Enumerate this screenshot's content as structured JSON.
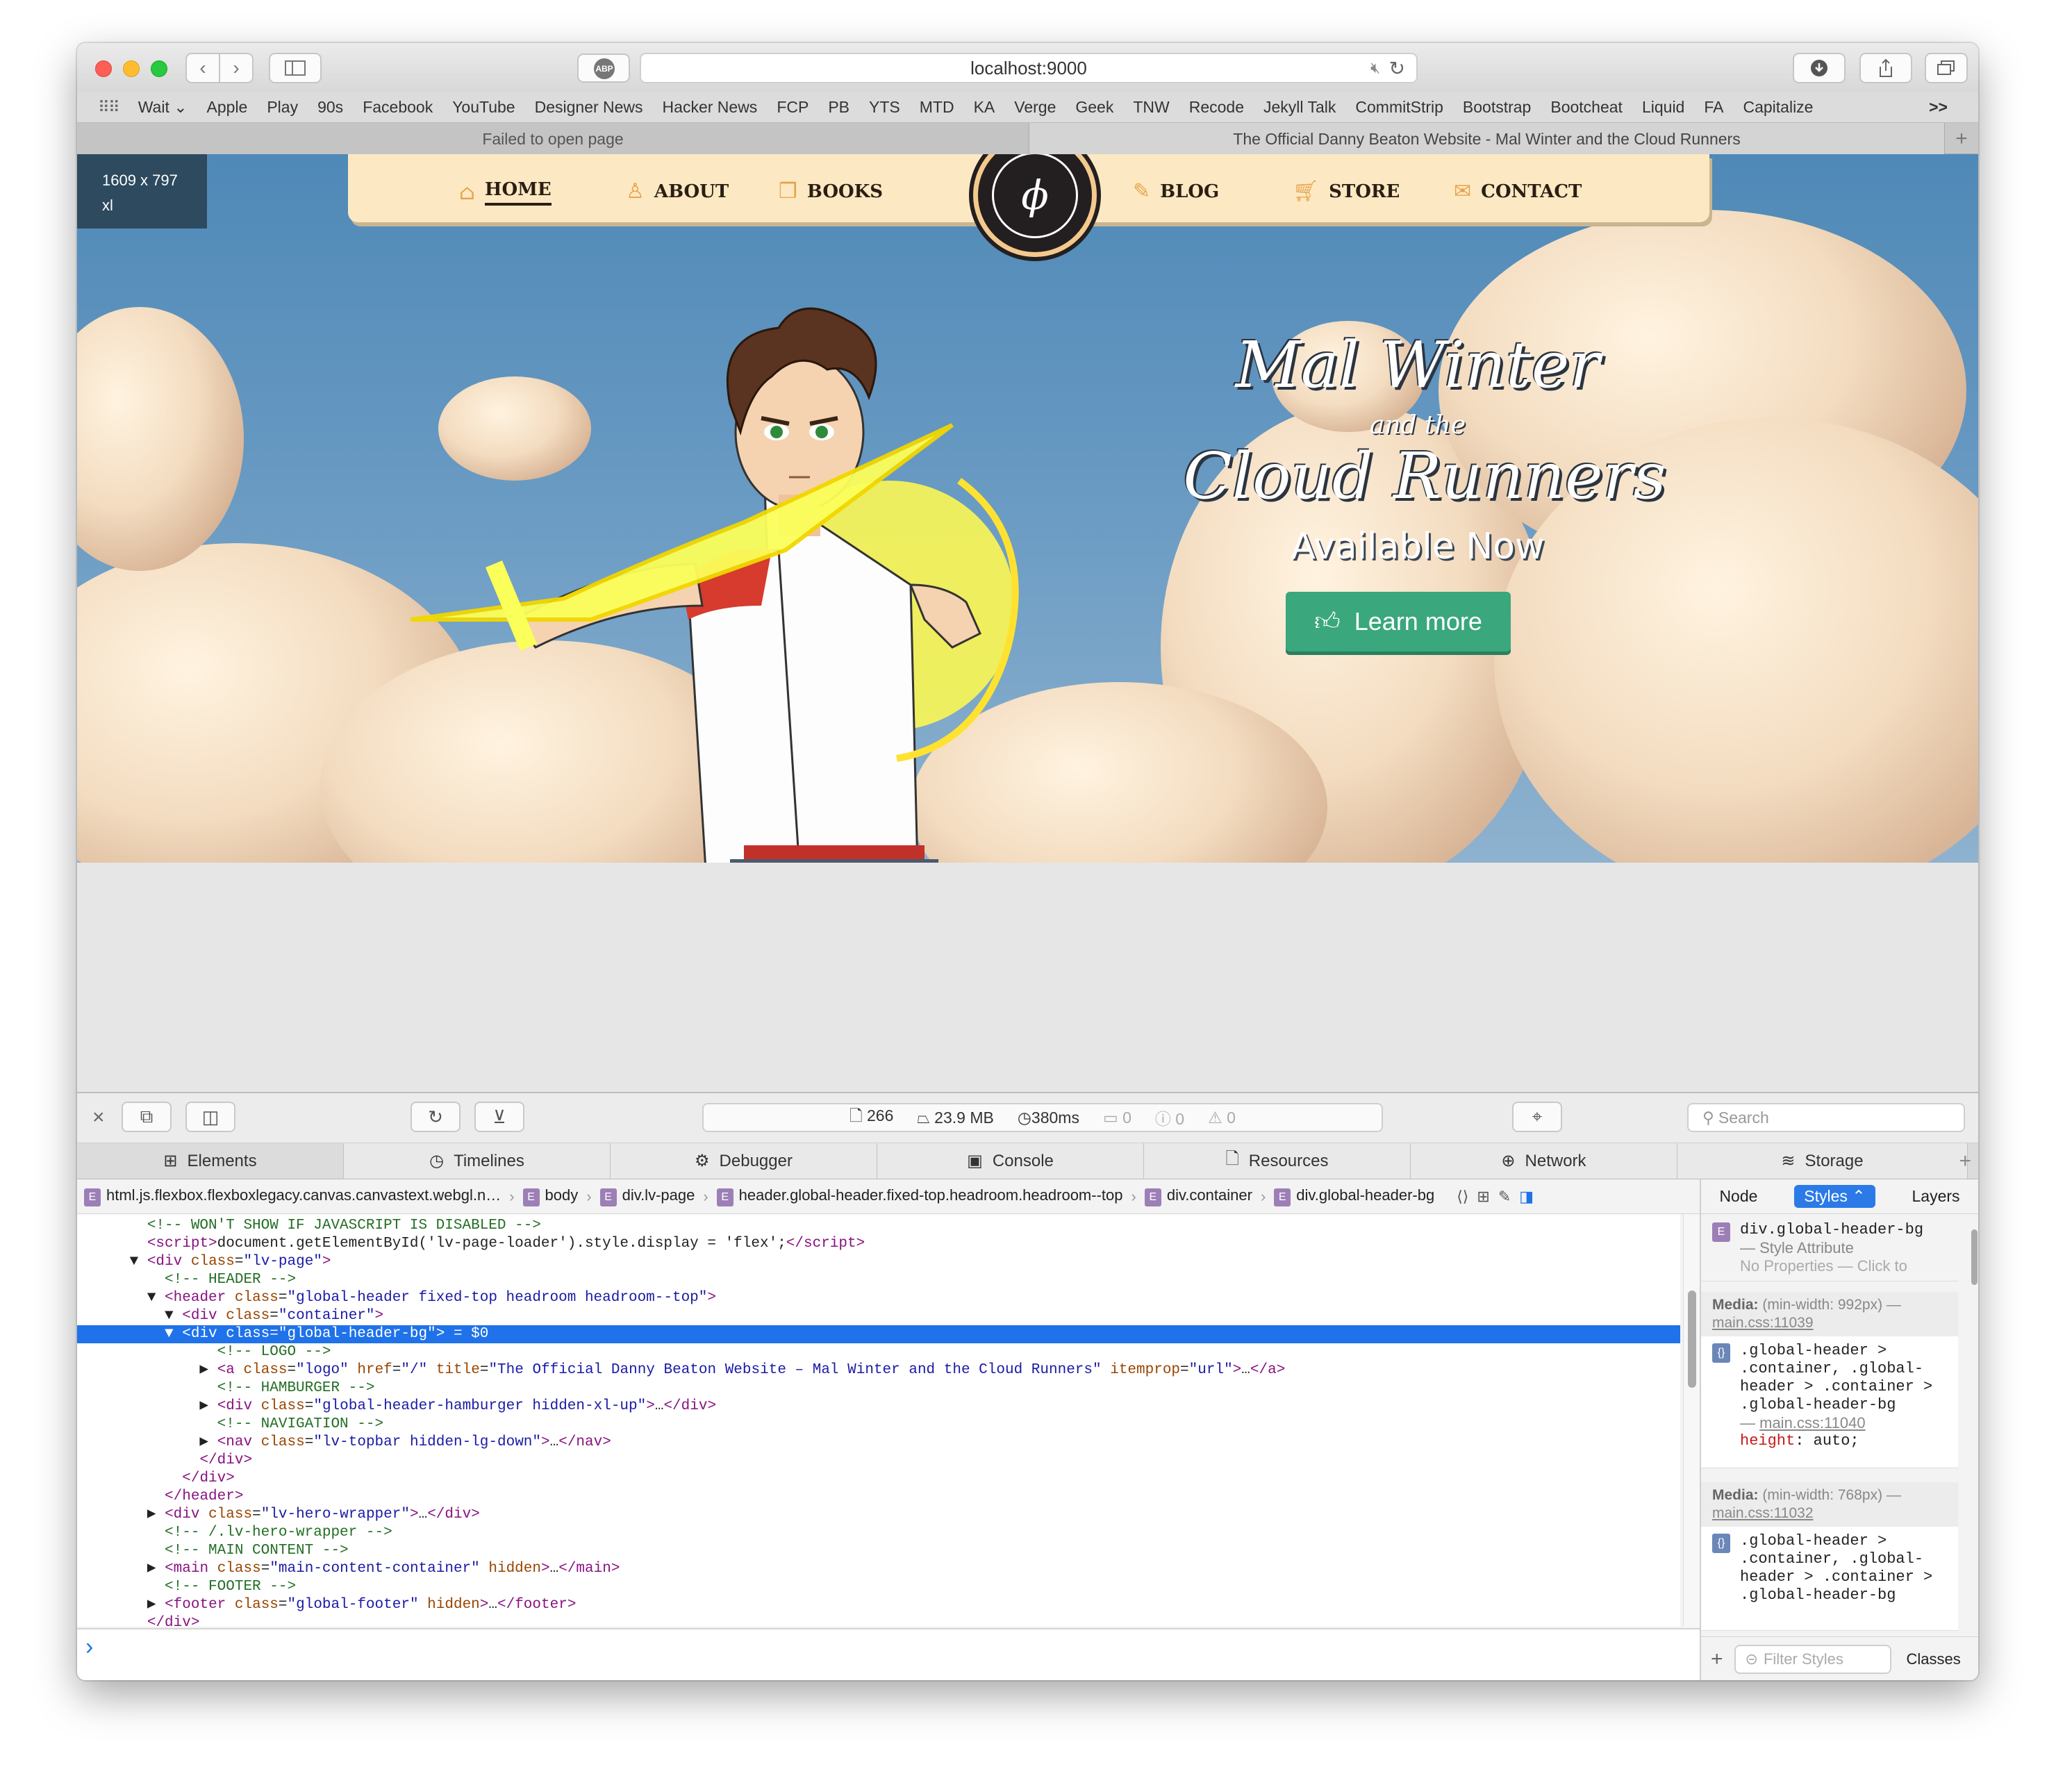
{
  "browser": {
    "url": "localhost:9000",
    "abp_label": "ABP",
    "bookmarks": [
      "Wait ⌄",
      "Apple",
      "Play",
      "90s",
      "Facebook",
      "YouTube",
      "Designer News",
      "Hacker News",
      "FCP",
      "PB",
      "YTS",
      "MTD",
      "KA",
      "Verge",
      "Geek",
      "TNW",
      "Recode",
      "Jekyll Talk",
      "CommitStrip",
      "Bootstrap",
      "Bootcheat",
      "Liquid",
      "FA",
      "Capitalize"
    ],
    "bookmarks_more": ">>",
    "tabs": [
      "Failed to open page",
      "The Official Danny Beaton Website - Mal Winter and the Cloud Runners"
    ],
    "new_tab": "+"
  },
  "page": {
    "viewport_size": "1609 x 797",
    "breakpoint": "xl",
    "nav": [
      "HOME",
      "ABOUT",
      "BOOKS",
      "BLOG",
      "STORE",
      "CONTACT"
    ],
    "title_line1": "Mal Winter",
    "title_line2": "and the",
    "title_line3": "Cloud Runners",
    "tagline": "Available Now",
    "cta": "Learn more"
  },
  "devtools": {
    "stats": {
      "resources": "266",
      "size": "23.9 MB",
      "time": "380ms",
      "logs": "0",
      "errors": "0",
      "warnings": "0"
    },
    "search_placeholder": "Search",
    "tabs": [
      "Elements",
      "Timelines",
      "Debugger",
      "Console",
      "Resources",
      "Network",
      "Storage"
    ],
    "breadcrumbs": [
      "html.js.flexbox.flexboxlegacy.canvas.canvastext.webgl.n…",
      "body",
      "div.lv-page",
      "header.global-header.fixed-top.headroom.headroom--top",
      "div.container",
      "div.global-header-bg"
    ],
    "sidebar_tabs": [
      "Node",
      "Styles",
      "Layers"
    ],
    "style_attr": {
      "selector": "div.global-header-bg",
      "label": "— Style Attribute",
      "empty": "No Properties — Click to"
    },
    "media1": {
      "label": "Media:",
      "query": "(min-width: 992px) —",
      "source": "main.css:11039"
    },
    "rule1": {
      "selector": ".global-header > .container, .global-header > .container > .global-header-bg",
      "source": "main.css:11040",
      "prop": "height",
      "value": "auto;"
    },
    "media2": {
      "label": "Media:",
      "query": "(min-width: 768px) —",
      "source": "main.css:11032"
    },
    "rule2": {
      "selector": ".global-header > .container, .global-header > .container > .global-header-bg"
    },
    "filter_placeholder": "Filter Styles",
    "classes_label": "Classes",
    "console_prompt": "›"
  }
}
